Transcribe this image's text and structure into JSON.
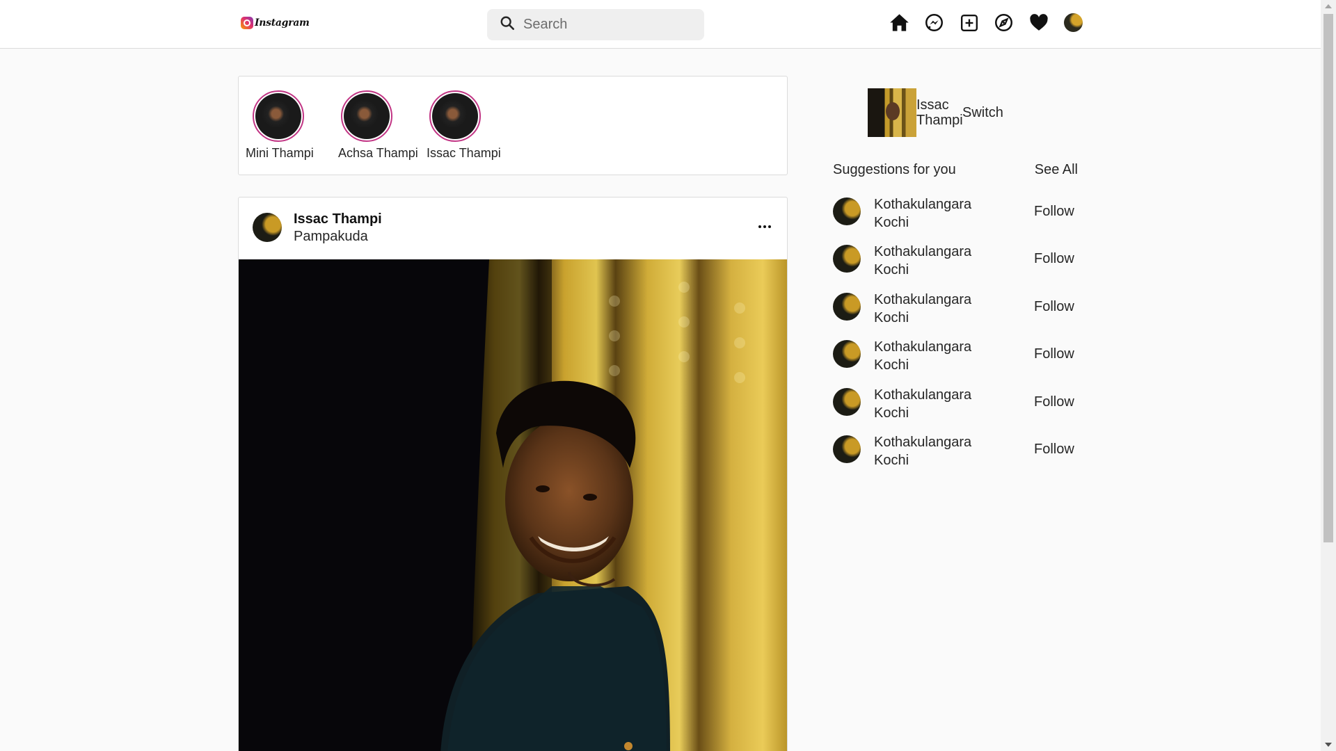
{
  "header": {
    "logo_text": "Instagram",
    "search_placeholder": "Search",
    "icons": [
      "home-icon",
      "messenger-icon",
      "new-post-icon",
      "explore-icon",
      "heart-icon",
      "profile-avatar"
    ]
  },
  "stories": [
    {
      "name": "Mini Thampi"
    },
    {
      "name": "Achsa Thampi"
    },
    {
      "name": "Issac Thampi"
    }
  ],
  "post": {
    "username": "Issac Thampi",
    "location": "Pampakuda"
  },
  "sidebar": {
    "profile_name": "Issac Thampi",
    "switch_label": "Switch",
    "suggestions_title": "Suggestions for you",
    "see_all_label": "See All",
    "suggestions": [
      {
        "name_line1": "Kothakulangara",
        "name_line2": "Kochi",
        "action": "Follow"
      },
      {
        "name_line1": "Kothakulangara",
        "name_line2": "Kochi",
        "action": "Follow"
      },
      {
        "name_line1": "Kothakulangara",
        "name_line2": "Kochi",
        "action": "Follow"
      },
      {
        "name_line1": "Kothakulangara",
        "name_line2": "Kochi",
        "action": "Follow"
      },
      {
        "name_line1": "Kothakulangara",
        "name_line2": "Kochi",
        "action": "Follow"
      },
      {
        "name_line1": "Kothakulangara",
        "name_line2": "Kochi",
        "action": "Follow"
      }
    ]
  },
  "colors": {
    "story_ring": "#c13584",
    "border": "#dbdbdb",
    "background": "#fafafa"
  }
}
